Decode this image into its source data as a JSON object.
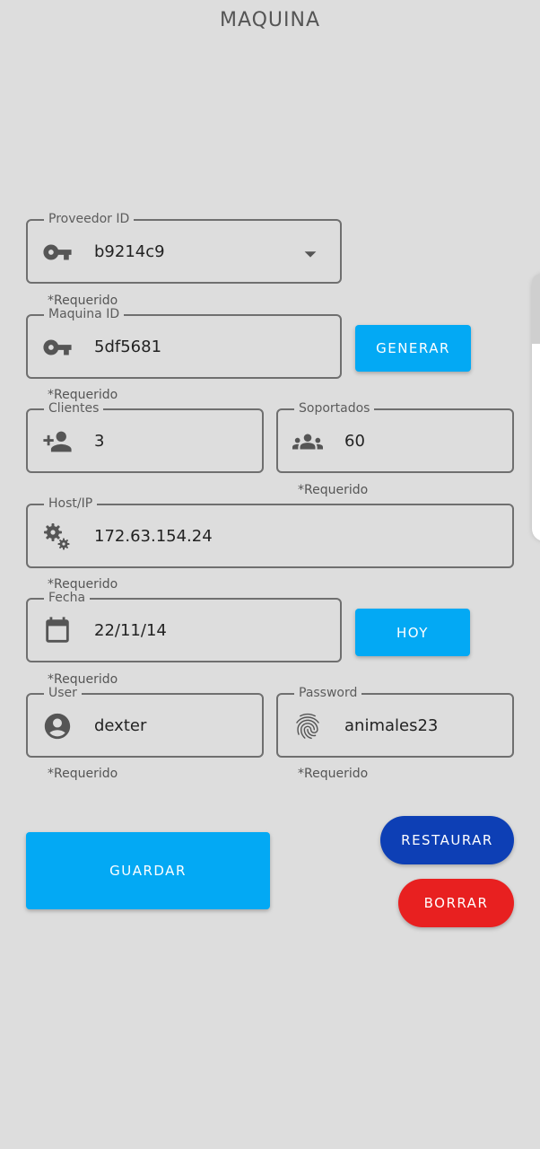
{
  "header": {
    "title": "MAQUINA"
  },
  "form": {
    "proveedor": {
      "label": "Proveedor ID",
      "value": "b9214c9",
      "hint": "*Requerido",
      "icon": "key-icon"
    },
    "maquina": {
      "label": "Maquina ID",
      "value": "5df5681",
      "hint": "*Requerido",
      "icon": "key-icon"
    },
    "clientes": {
      "label": "Clientes",
      "value": "3",
      "icon": "person-add-icon"
    },
    "soportados": {
      "label": "Soportados",
      "value": "60",
      "hint": "*Requerido",
      "icon": "people-icon"
    },
    "host": {
      "label": "Host/IP",
      "value": "172.63.154.24",
      "hint": "*Requerido",
      "icon": "gears-icon"
    },
    "fecha": {
      "label": "Fecha",
      "value": "22/11/14",
      "hint": "*Requerido",
      "icon": "calendar-icon"
    },
    "user": {
      "label": "User",
      "value": "dexter",
      "hint": "*Requerido",
      "icon": "account-circle-icon"
    },
    "password": {
      "label": "Password",
      "value": "animales23",
      "hint": "*Requerido",
      "icon": "fingerprint-icon"
    }
  },
  "buttons": {
    "generar": "GENERAR",
    "hoy": "HOY",
    "guardar": "GUARDAR",
    "restaurar": "RESTAURAR",
    "borrar": "BORRAR"
  },
  "colors": {
    "background": "#dddddd",
    "primary": "#03a9f4",
    "restaurar": "#0d3fb5",
    "borrar": "#e82020",
    "border": "#6f6f6f"
  }
}
